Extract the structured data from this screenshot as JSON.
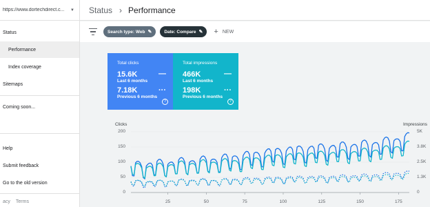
{
  "property": {
    "url": "https://www.dortechdirect.c..."
  },
  "sidebar": {
    "items": [
      {
        "label": "Status"
      },
      {
        "label": "Performance"
      },
      {
        "label": "Index coverage"
      },
      {
        "label": "Sitemaps"
      },
      {
        "label": "Coming soon..."
      },
      {
        "label": "Help"
      },
      {
        "label": "Submit feedback"
      },
      {
        "label": "Go to the old version"
      }
    ],
    "footer": {
      "privacy": "acy",
      "terms": "Terms"
    }
  },
  "header": {
    "crumb": "Status",
    "title": "Performance"
  },
  "filters": {
    "search_type": "Search type: Web",
    "date": "Date: Compare",
    "new_label": "NEW"
  },
  "cards": {
    "clicks": {
      "title": "Total clicks",
      "current_value": "15.6K",
      "current_label": "Last 6 months",
      "previous_value": "7.18K",
      "previous_label": "Previous 6 months"
    },
    "impressions": {
      "title": "Total impressions",
      "current_value": "466K",
      "current_label": "Last 6 months",
      "previous_value": "198K",
      "previous_label": "Previous 6 months"
    }
  },
  "colors": {
    "clicks": "#4285f4",
    "impressions": "#12b5cb",
    "clicks_line": "#1a73e8",
    "impressions_line": "#12b5cb"
  },
  "chart_data": {
    "type": "line",
    "left_axis_title": "Clicks",
    "right_axis_title": "Impressions",
    "left_ticks": [
      "200",
      "150",
      "100",
      "50",
      "0"
    ],
    "right_ticks": [
      "5K",
      "3.8K",
      "2.5K",
      "1.3K",
      "0"
    ],
    "x_ticks": [
      "25",
      "50",
      "75",
      "100",
      "125",
      "150",
      "175"
    ],
    "xlim": [
      1,
      182
    ],
    "ylim_left": [
      0,
      200
    ],
    "ylim_right": [
      0,
      5000
    ],
    "series": [
      {
        "key": "clicks_last",
        "axis": "left",
        "style": "solid",
        "color": "#1a73e8",
        "base": [
          75,
          80,
          85,
          90,
          95,
          105,
          115,
          125,
          130,
          135,
          140,
          145,
          155,
          170
        ],
        "weekly_amp": 55
      },
      {
        "key": "impressions_last",
        "axis": "right",
        "style": "solid",
        "color": "#12b5cb",
        "base": [
          1900,
          1800,
          2000,
          2100,
          2200,
          2300,
          2500,
          2700,
          2800,
          2900,
          3000,
          3100,
          3300,
          3700
        ],
        "weekly_amp": 1100
      },
      {
        "key": "clicks_previous",
        "axis": "left",
        "style": "dotted",
        "color": "#1a73e8",
        "base": [
          30,
          28,
          32,
          35,
          33,
          38,
          40,
          42,
          45,
          45,
          48,
          50,
          55,
          60
        ],
        "weekly_amp": 22
      },
      {
        "key": "impressions_previous",
        "axis": "right",
        "style": "dotted",
        "color": "#12b5cb",
        "base": [
          800,
          780,
          820,
          850,
          870,
          900,
          950,
          1000,
          1050,
          1050,
          1100,
          1150,
          1250,
          1350
        ],
        "weekly_amp": 450
      }
    ]
  }
}
